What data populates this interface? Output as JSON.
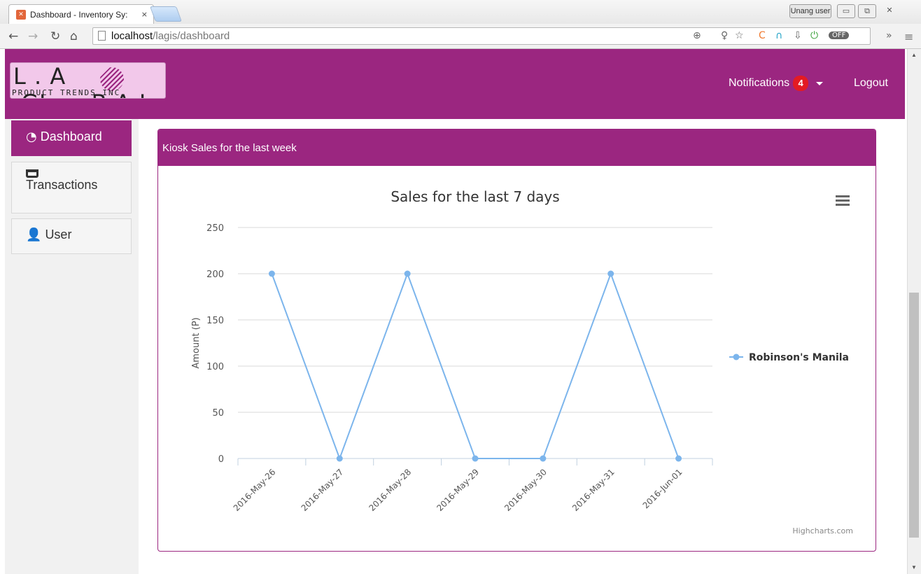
{
  "browser": {
    "tab_title": "Dashboard - Inventory Sy:",
    "tab_close": "×",
    "user_button": "Unang user",
    "url_host": "localhost",
    "url_path": "/lagis/dashboard"
  },
  "header": {
    "logo_big": "L . A .GL   B A L",
    "logo_small": "PRODUCT TRENDS INC.",
    "notifications_label": "Notifications",
    "notifications_count": "4",
    "logout_label": "Logout"
  },
  "sidebar": {
    "items": [
      {
        "label": "Dashboard",
        "icon": "dashboard-icon",
        "active": true
      },
      {
        "label": "Transactions",
        "icon": "cart-icon",
        "active": false
      },
      {
        "label": "User",
        "icon": "user-icon",
        "active": false
      }
    ]
  },
  "panel": {
    "title": "Kiosk Sales for the last week"
  },
  "colors": {
    "brand": "#9b2680",
    "series": "#7cb5ec",
    "badge": "#e31b23"
  },
  "chart_data": {
    "type": "line",
    "title": "Sales for the last 7 days",
    "ylabel": "Amount (P)",
    "xlabel": "",
    "ylim": [
      0,
      250
    ],
    "yticks": [
      0,
      50,
      100,
      150,
      200,
      250
    ],
    "categories": [
      "2016-May-26",
      "2016-May-27",
      "2016-May-28",
      "2016-May-29",
      "2016-May-30",
      "2016-May-31",
      "2016-Jun-01"
    ],
    "series": [
      {
        "name": "Robinson's Manila",
        "values": [
          200,
          0,
          200,
          0,
          0,
          200,
          0
        ]
      }
    ],
    "legend": "right",
    "grid": true,
    "credit": "Highcharts.com"
  }
}
